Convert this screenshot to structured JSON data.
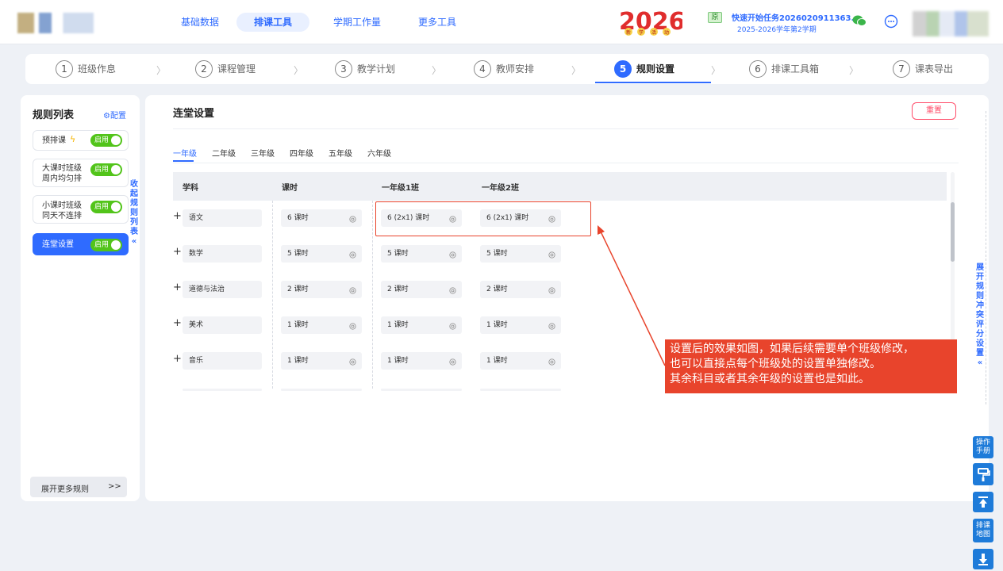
{
  "header": {
    "nav": [
      "基础数据",
      "排课工具",
      "学期工作量",
      "更多工具"
    ],
    "active_nav": "排课工具",
    "banner_year": "2026",
    "banner_sub": [
      "新",
      "学",
      "活",
      "动"
    ],
    "task_badge": "原",
    "task_title": "快速开始任务2026020911363...",
    "task_term": "2025-2026学年第2学期"
  },
  "steps": [
    {
      "num": "1",
      "label": "班级作息"
    },
    {
      "num": "2",
      "label": "课程管理"
    },
    {
      "num": "3",
      "label": "教学计划"
    },
    {
      "num": "4",
      "label": "教师安排"
    },
    {
      "num": "5",
      "label": "规则设置"
    },
    {
      "num": "6",
      "label": "排课工具箱"
    },
    {
      "num": "7",
      "label": "课表导出"
    }
  ],
  "sidebar": {
    "title": "规则列表",
    "config_label": "⚙配置",
    "rules": [
      {
        "label": "预排课",
        "toggle": "启用"
      },
      {
        "label": "大课时班级周内均匀排",
        "line1": "大课时班级",
        "line2": "周内均匀排",
        "toggle": "启用"
      },
      {
        "label": "小课时班级同天不连排",
        "line1": "小课时班级",
        "line2": "同天不连排",
        "toggle": "启用"
      },
      {
        "label": "连堂设置",
        "toggle": "启用"
      }
    ],
    "collapse_label": [
      "收",
      "起",
      "规",
      "则",
      "列",
      "表",
      "«"
    ],
    "more_rules": "展开更多规则",
    "more_arrow": ">>"
  },
  "main": {
    "title": "连堂设置",
    "reset_label": "重置",
    "grade_tabs": [
      "一年级",
      "二年级",
      "三年级",
      "四年级",
      "五年级",
      "六年级"
    ],
    "active_grade": "一年级",
    "columns": [
      "学科",
      "课时",
      "一年级1班",
      "一年级2班"
    ],
    "rows": [
      {
        "plus": "+",
        "subject": "语文",
        "hours": "6 课时",
        "class1": "6 (2x1) 课时",
        "class2": "6 (2x1) 课时"
      },
      {
        "plus": "+",
        "subject": "数学",
        "hours": "5 课时",
        "class1": "5 课时",
        "class2": "5 课时"
      },
      {
        "plus": "+",
        "subject": "道德与法治",
        "hours": "2 课时",
        "class1": "2 课时",
        "class2": "2 课时"
      },
      {
        "plus": "+",
        "subject": "美术",
        "hours": "1 课时",
        "class1": "1 课时",
        "class2": "1 课时"
      },
      {
        "plus": "+",
        "subject": "音乐",
        "hours": "1 课时",
        "class1": "1 课时",
        "class2": "1 课时"
      }
    ]
  },
  "annotation": {
    "lines": [
      "设置后的效果如图，如果后续需要单个班级修改，",
      "也可以直接点每个班级处的设置单独修改。",
      "其余科目或者其余年级的设置也是如此。"
    ]
  },
  "right_panel": {
    "expand_label": [
      "展",
      "开",
      "规",
      "则",
      "冲",
      "突",
      "评",
      "分",
      "设",
      "置",
      "«"
    ],
    "manual": [
      "操作",
      "手册"
    ],
    "map": [
      "排课",
      "地图"
    ]
  },
  "colors": {
    "accent": "#2f6bff",
    "toggle_on": "#52c41a",
    "annotation": "#e8442c",
    "reset": "#ff4d6a"
  }
}
